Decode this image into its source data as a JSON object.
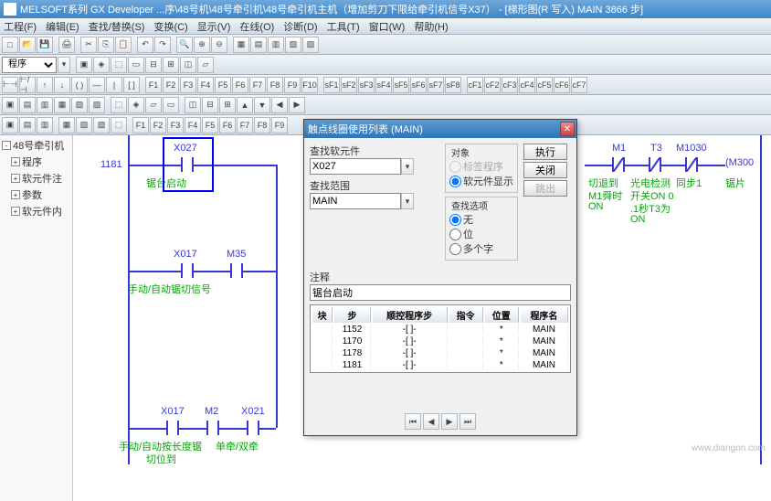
{
  "titlebar": "MELSOFT系列 GX Developer ...序\\48号机\\48号牵引机\\48号牵引机主机（增加剪刀下限给牵引机信号X37） - [梯形图(R 写入)    MAIN    3866 步]",
  "menu": [
    "工程(F)",
    "编辑(E)",
    "查找/替换(S)",
    "变换(C)",
    "显示(V)",
    "在线(O)",
    "诊断(D)",
    "工具(T)",
    "窗口(W)",
    "帮助(H)"
  ],
  "combo1": "程序",
  "tree": {
    "root": "48号牵引机",
    "items": [
      "程序",
      "软元件注",
      "参数",
      "软元件内"
    ]
  },
  "ladder": {
    "step1": "1181",
    "x027": "X027",
    "x027_cmt": "锯台启动",
    "x017": "X017",
    "m35": "M35",
    "row2_cmt": "手动/自动锯切信号",
    "m2": "M2",
    "x021": "X021",
    "row3_cmt1": "手动/自动按长度锯",
    "row3_cmt2": "单牵/双牵",
    "row3_cmt3": "切位到",
    "m1": "M1",
    "t3": "T3",
    "m1030": "M1030",
    "m300": "(M300",
    "rcmt1": "切退到",
    "rcmt2": "M1舜时",
    "rcmt3": "ON",
    "rcmt4": "光电检测",
    "rcmt5": "开关ON 0",
    "rcmt6": ".1秒T3为",
    "rcmt7": "ON",
    "rcmt8": "同步1",
    "rcmt9": "锯片"
  },
  "dialog": {
    "title": "触点线圈使用列表 (MAIN)",
    "find_lbl": "查找软元件",
    "find_val": "X027",
    "range_lbl": "查找范围",
    "range_val": "MAIN",
    "target_grp": "对象",
    "opt1": "标签程序",
    "opt2": "软元件显示",
    "option_grp": "查找选项",
    "optA": "无",
    "optB": "位",
    "optC": "多个字",
    "comment_lbl": "注释",
    "comment_val": "锯台启动",
    "btn_exec": "执行",
    "btn_close": "关闭",
    "btn_out": "跳出",
    "cols": [
      "块",
      "步",
      "顺控程序步",
      "指令",
      "位置",
      "程序名"
    ],
    "rows": [
      {
        "step": "1152",
        "pos": "*",
        "prg": "MAIN"
      },
      {
        "step": "1170",
        "pos": "*",
        "prg": "MAIN"
      },
      {
        "step": "1178",
        "pos": "*",
        "prg": "MAIN"
      },
      {
        "step": "1181",
        "pos": "*",
        "prg": "MAIN"
      }
    ]
  },
  "watermark": "www.diangon.com"
}
